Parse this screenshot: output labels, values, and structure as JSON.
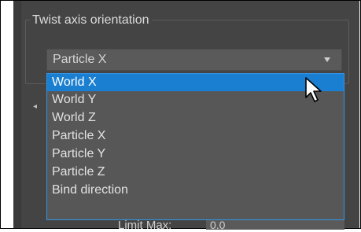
{
  "group": {
    "title": "Twist axis orientation"
  },
  "combo": {
    "value": "Particle X"
  },
  "dropdown": {
    "options": [
      "World X",
      "World Y",
      "World Z",
      "Particle X",
      "Particle Y",
      "Particle Z",
      "Bind direction"
    ],
    "selected_index": 0
  },
  "bottom_row": {
    "label": "Limit Max:",
    "value": "0.0"
  },
  "colors": {
    "panel_bg": "#444444",
    "selection": "#1b7fd1",
    "dropdown_border": "#3295e8",
    "text": "#e2e2e2"
  },
  "icons": [
    "dropdown-arrow-icon",
    "mouse-pointer-icon"
  ]
}
